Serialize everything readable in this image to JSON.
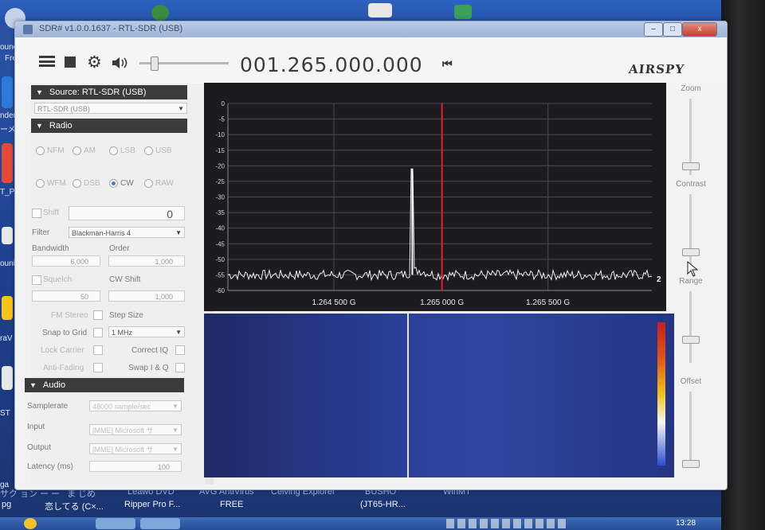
{
  "window": {
    "title": "SDR# v1.0.0.1637 - RTL-SDR (USB)",
    "min": "–",
    "max": "□",
    "close": "x"
  },
  "toolbar": {
    "frequency": "001.265.000.000",
    "logo": "AIRSPY"
  },
  "source": {
    "header": "Source: RTL-SDR (USB)",
    "device": "RTL-SDR (USB)"
  },
  "radio": {
    "header": "Radio",
    "modes_row1": [
      "NFM",
      "AM",
      "LSB",
      "USB"
    ],
    "modes_row2": [
      "WFM",
      "DSB",
      "CW",
      "RAW"
    ],
    "selected_mode": "CW",
    "shift_label": "Shift",
    "shift_value": "0",
    "filter_label": "Filter",
    "filter_value": "Blackman-Harris 4",
    "bandwidth_label": "Bandwidth",
    "bandwidth_value": "6,000",
    "order_label": "Order",
    "order_value": "1,000",
    "squelch_label": "Squelch",
    "squelch_value": "50",
    "cwshift_label": "CW Shift",
    "cwshift_value": "1,000",
    "fmstereo_label": "FM Stereo",
    "stepsize_label": "Step Size",
    "snap_label": "Snap to Grid",
    "snap_value": "1 MHz",
    "lockcarrier_label": "Lock Carrier",
    "correctiq_label": "Correct IQ",
    "antifading_label": "Anti-Fading",
    "swapiq_label": "Swap I & Q"
  },
  "audio": {
    "header": "Audio",
    "samplerate_label": "Samplerate",
    "samplerate_value": "48000 sample/sec",
    "input_label": "Input",
    "input_value": "[MME] Microsoft サ",
    "output_label": "Output",
    "output_value": "[MME] Microsoft サ",
    "latency_label": "Latency (ms)",
    "latency_value": "100"
  },
  "right_controls": {
    "zoom": "Zoom",
    "contrast": "Contrast",
    "range": "Range",
    "offset": "Offset"
  },
  "spectrum": {
    "side_value": "2",
    "freq_labels": [
      "1.264 500 G",
      "1.265 000 G",
      "1.265 500 G"
    ]
  },
  "chart_data": {
    "type": "line",
    "y_ticks": [
      0,
      -5,
      -10,
      -15,
      -20,
      -25,
      -30,
      -35,
      -40,
      -45,
      -50,
      -55,
      -60
    ],
    "ylim": [
      -60,
      0
    ],
    "x_ticks": [
      "1.264 500 G",
      "1.265 000 G",
      "1.265 500 G"
    ],
    "center_frequency": "1.265 000 G",
    "noise_floor_db": -55,
    "peak": {
      "x": "1.264 900 G",
      "y": -21
    },
    "grid": true
  },
  "desktop": {
    "labels": [
      "ounc",
      "Fre",
      "nders",
      "ーメ",
      "T_P",
      "ouni",
      "raV",
      "ST",
      "ga"
    ],
    "taskbar_row1": [
      "サク ョン ー ー",
      "ま じめ",
      "Leawo DVD",
      "AVG AntiVirus",
      "Ceiving Explorer",
      "BUSHO",
      "WinMT"
    ],
    "taskbar_row2": [
      "pg",
      "恋してる (C×...",
      "Ripper Pro F...",
      "FREE",
      "(JT65-HR..."
    ],
    "clock": "13:28"
  },
  "colors": {
    "accent": "#4a78c8",
    "marker": "#e0202a",
    "trace": "#f0f0f0"
  }
}
